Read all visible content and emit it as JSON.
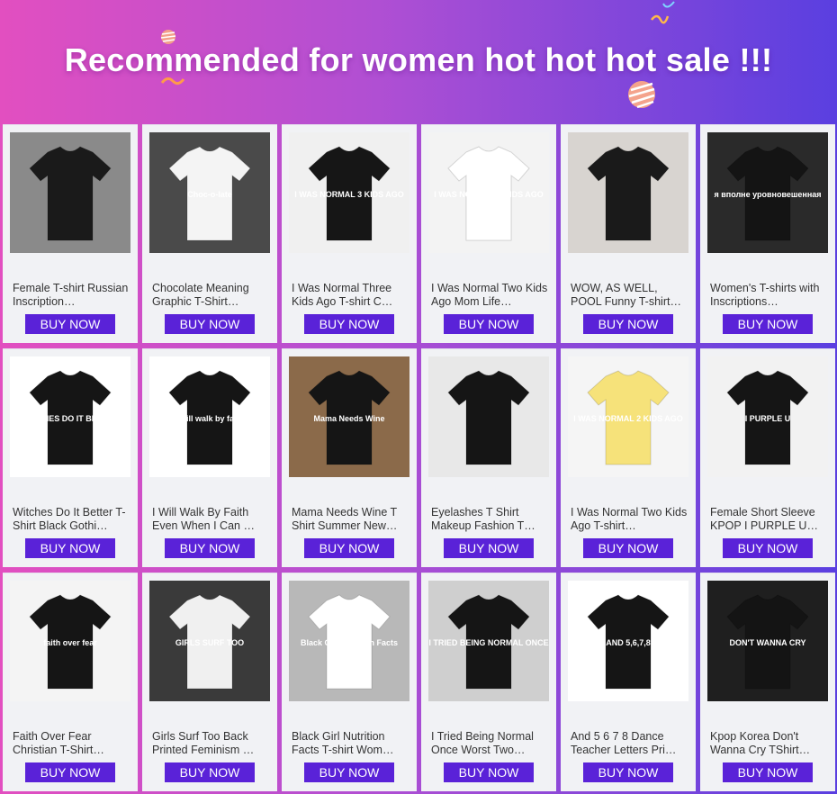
{
  "header": {
    "title": "Recommended for women hot hot hot sale !!!",
    "accent": "#5a22d8"
  },
  "products": [
    {
      "name": "Female T-shirt Russian Inscription…",
      "button": "BUY NOW",
      "bg": "#8a8a8a",
      "shirt": "#1a1a1a",
      "print": "",
      "print_color": "#ffffff"
    },
    {
      "name": "Chocolate Meaning Graphic T-Shirt…",
      "button": "BUY NOW",
      "bg": "#4a4a4a",
      "shirt": "#f4f4f4",
      "print": "Choc-o-late",
      "print_color": "#222222"
    },
    {
      "name": "I Was Normal Three Kids Ago T-shirt C…",
      "button": "BUY NOW",
      "bg": "#f0f0f0",
      "shirt": "#161616",
      "print": "I WAS NORMAL 3 KIDS AGO",
      "print_color": "#ffffff"
    },
    {
      "name": "I Was Normal Two Kids Ago Mom Life…",
      "button": "BUY NOW",
      "bg": "#f3f3f3",
      "shirt": "#ffffff",
      "print": "I WAS NORMAL 2 KIDS AGO",
      "print_color": "#222222"
    },
    {
      "name": "WOW, AS WELL, POOL Funny T-shirt…",
      "button": "BUY NOW",
      "bg": "#d8d4d0",
      "shirt": "#1a1a1a",
      "print": "",
      "print_color": "#ffffff"
    },
    {
      "name": "Women's T-shirts with Inscriptions…",
      "button": "BUY NOW",
      "bg": "#2a2a2a",
      "shirt": "#141414",
      "print": "я вполне уровновешенная",
      "print_color": "#ffffff"
    },
    {
      "name": "Witches Do It Better T-Shirt Black Gothi…",
      "button": "BUY NOW",
      "bg": "#ffffff",
      "shirt": "#151515",
      "print": "WITCHES DO IT BETTER",
      "print_color": "#ffffff"
    },
    {
      "name": "I Will Walk By Faith Even When I Can …",
      "button": "BUY NOW",
      "bg": "#ffffff",
      "shirt": "#151515",
      "print": "I will walk by faith",
      "print_color": "#ffffff"
    },
    {
      "name": "Mama Needs Wine T Shirt Summer New…",
      "button": "BUY NOW",
      "bg": "#8b6a4a",
      "shirt": "#151515",
      "print": "Mama Needs Wine",
      "print_color": "#ffffff"
    },
    {
      "name": "Eyelashes T Shirt Makeup Fashion T…",
      "button": "BUY NOW",
      "bg": "#e8e8e8",
      "shirt": "#151515",
      "print": "",
      "print_color": "#ffffff"
    },
    {
      "name": "I Was Normal Two Kids Ago T-shirt…",
      "button": "BUY NOW",
      "bg": "#f5f5f5",
      "shirt": "#f6e27a",
      "print": "I WAS NORMAL 2 KIDS AGO",
      "print_color": "#222222"
    },
    {
      "name": "Female Short Sleeve KPOP I PURPLE U…",
      "button": "BUY NOW",
      "bg": "#f2f2f2",
      "shirt": "#151515",
      "print": "I PURPLE U",
      "print_color": "#ffffff"
    },
    {
      "name": "Faith Over Fear Christian T-Shirt…",
      "button": "BUY NOW",
      "bg": "#f4f4f4",
      "shirt": "#151515",
      "print": "faith over fear",
      "print_color": "#ffffff"
    },
    {
      "name": "Girls Surf Too Back Printed Feminism …",
      "button": "BUY NOW",
      "bg": "#3a3a3a",
      "shirt": "#f0f0f0",
      "print": "GIRLS SURF TOO",
      "print_color": "#222222"
    },
    {
      "name": "Black Girl Nutrition Facts T-shirt Wom…",
      "button": "BUY NOW",
      "bg": "#b8b8b8",
      "shirt": "#ffffff",
      "print": "Black Girl Nutrition Facts",
      "print_color": "#222222"
    },
    {
      "name": "I Tried Being Normal Once Worst Two…",
      "button": "BUY NOW",
      "bg": "#cfcfcf",
      "shirt": "#151515",
      "print": "I TRIED BEING NORMAL ONCE",
      "print_color": "#ffffff"
    },
    {
      "name": "And 5 6 7 8 Dance Teacher Letters Pri…",
      "button": "BUY NOW",
      "bg": "#ffffff",
      "shirt": "#151515",
      "print": "AND 5,6,7,8",
      "print_color": "#ffffff"
    },
    {
      "name": "Kpop Korea Don't Wanna Cry TShirt…",
      "button": "BUY NOW",
      "bg": "#1f1f1f",
      "shirt": "#141414",
      "print": "DON'T WANNA CRY",
      "print_color": "#ffffff"
    }
  ]
}
